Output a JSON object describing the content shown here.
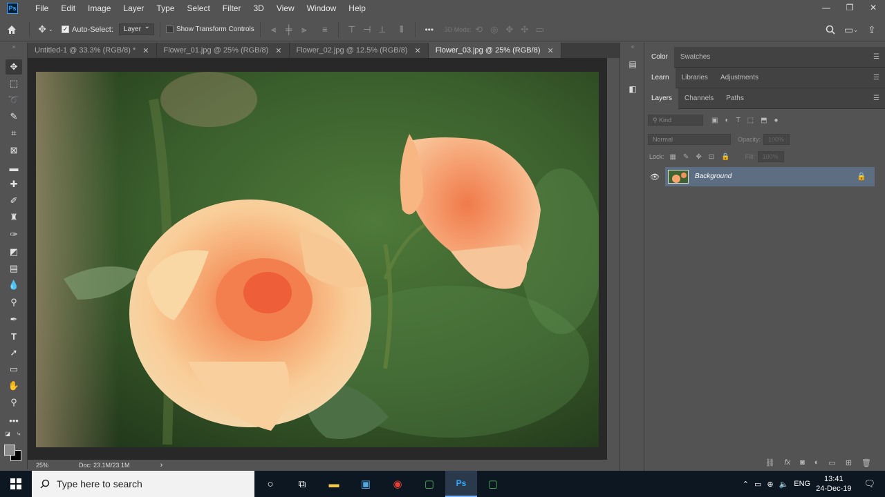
{
  "menubar": {
    "logo": "Ps",
    "items": [
      "File",
      "Edit",
      "Image",
      "Layer",
      "Type",
      "Select",
      "Filter",
      "3D",
      "View",
      "Window",
      "Help"
    ],
    "window_controls": {
      "minimize": "—",
      "restore": "❐",
      "close": "✕"
    }
  },
  "options": {
    "autoselect_label": "Auto-Select:",
    "autoselect_checked": true,
    "autoselect_target": "Layer",
    "transform_label": "Show Transform Controls",
    "transform_checked": false,
    "mode3d_label": "3D Mode:",
    "more": "•••"
  },
  "tabs": [
    {
      "label": "Untitled-1 @ 33.3% (RGB/8) *",
      "active": false
    },
    {
      "label": "Flower_01.jpg @ 25% (RGB/8)",
      "active": false
    },
    {
      "label": "Flower_02.jpg @ 12.5% (RGB/8)",
      "active": false
    },
    {
      "label": "Flower_03.jpg @ 25% (RGB/8)",
      "active": true
    }
  ],
  "status": {
    "zoom": "25%",
    "doc": "Doc: 23.1M/23.1M",
    "arrow": "›"
  },
  "panels": {
    "group1": [
      "Color",
      "Swatches"
    ],
    "group2": [
      "Learn",
      "Libraries",
      "Adjustments"
    ],
    "group3": [
      "Layers",
      "Channels",
      "Paths"
    ],
    "kind_placeholder": "Kind",
    "blend_mode": "Normal",
    "opacity_label": "Opacity:",
    "opacity_value": "100%",
    "lock_label": "Lock:",
    "fill_label": "Fill:",
    "fill_value": "100%",
    "layer_name": "Background"
  },
  "taskbar": {
    "search_placeholder": "Type here to search",
    "language": "ENG",
    "time": "13:41",
    "date": "24-Dec-19"
  },
  "colors": {
    "foreground": "#8a8a8a",
    "background": "#000000",
    "selection": "#5d6d82",
    "accent": "#31a8ff"
  }
}
